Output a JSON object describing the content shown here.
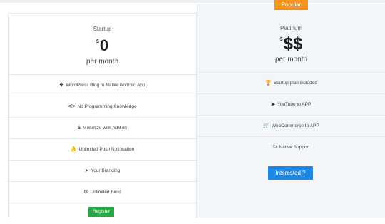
{
  "badge": "Popular",
  "startup": {
    "name": "Startup",
    "currency": "$",
    "price": "0",
    "period": "per month",
    "features": [
      {
        "icon": "wordpress-icon",
        "glyph": "✤",
        "label": "WordPress Blog to Native Android App"
      },
      {
        "icon": "code-icon",
        "glyph": "</>",
        "label": "No Programming Knowledge"
      },
      {
        "icon": "dollar-icon",
        "glyph": "$",
        "label": "Monetize with AdMob"
      },
      {
        "icon": "bell-icon",
        "glyph": "🔔",
        "label": "Unlimited Push Notification"
      },
      {
        "icon": "paper-plane-icon",
        "glyph": "➤",
        "label": "Your Branding"
      },
      {
        "icon": "gear-icon",
        "glyph": "⚙",
        "label": "Unlimited Build"
      }
    ],
    "button": "Register"
  },
  "platinum": {
    "name": "Platinum",
    "currency": "$",
    "price": "$$",
    "period": "per month",
    "features": [
      {
        "icon": "trophy-icon",
        "glyph": "🏆",
        "label": "Startup plan included"
      },
      {
        "icon": "youtube-icon",
        "glyph": "▶",
        "label": "YouTube to APP"
      },
      {
        "icon": "cart-icon",
        "glyph": "🛒",
        "label": "WooCommerce to APP"
      },
      {
        "icon": "refresh-icon",
        "glyph": "↻",
        "label": "Native Support"
      }
    ],
    "button": "Interested ?"
  },
  "colors": {
    "badge": "#f7941d",
    "register": "#28a745",
    "interested": "#1e88e5",
    "platinum_bg": "#f2f6f9"
  }
}
